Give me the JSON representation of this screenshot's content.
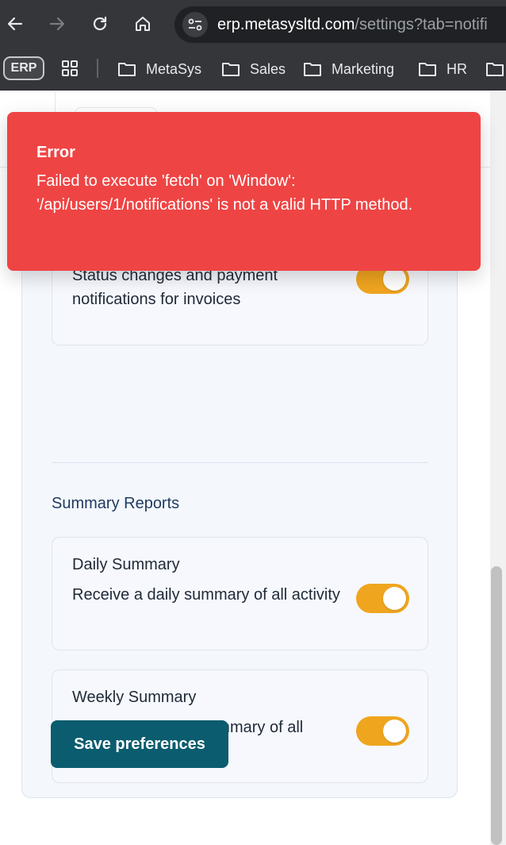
{
  "browser": {
    "url_host": "erp.metasysltd.com",
    "url_path": "/settings?tab=notifi",
    "bookmarks": [
      {
        "label": "ERP"
      },
      {
        "label": "MetaSys"
      },
      {
        "label": "Sales"
      },
      {
        "label": "Marketing"
      },
      {
        "label": "HR"
      }
    ]
  },
  "notifications": {
    "invoice_pref": {
      "description": "Status changes and payment notifications for invoices",
      "enabled": true
    },
    "summary_section_title": "Summary Reports",
    "daily": {
      "title": "Daily Summary",
      "description": "Receive a daily summary of all activity",
      "enabled": true
    },
    "weekly": {
      "title": "Weekly Summary",
      "description": "Receive a weekly summary of all activity",
      "enabled": true
    },
    "save_label": "Save preferences"
  },
  "toast": {
    "title": "Error",
    "message": "Failed to execute 'fetch' on 'Window': '/api/users/1/notifications' is not a valid HTTP method."
  },
  "colors": {
    "toggle_on": "#f0a51f",
    "primary_button": "#0b5c6e",
    "error_toast": "#ef4444"
  }
}
